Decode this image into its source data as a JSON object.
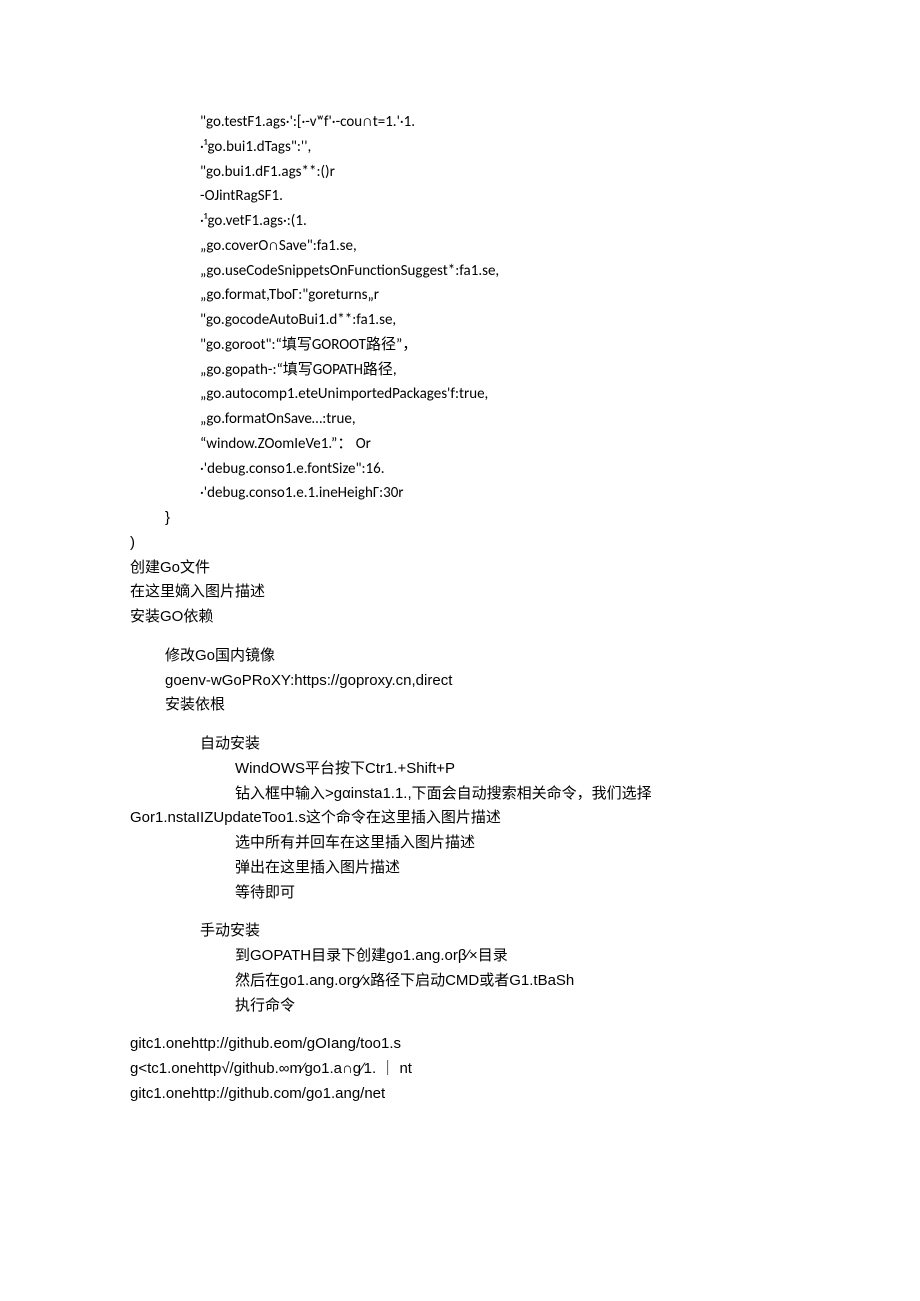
{
  "code": {
    "l1": "\"go.testF1.ags·':[·-vʷf'·-cou∩t=1.'·1.",
    "l2": "·¹go.bui1.dTags\":'',",
    "l3": "\"go.bui1.dF1.ags**:()r",
    "l4": "-OJintRagSF1.",
    "l5": "·¹go.vetF1.ags·:(1.",
    "l6": "„go.coverO∩Save\":fa1.se,",
    "l7": "„go.useCodeSnippetsOnFunctionSuggest*:fa1.se,",
    "l8": "„go.format,TboΓ:\"goreturns„r",
    "l9": "\"go.gocodeAutoBui1.d**:fa1.se,",
    "l10": "\"go.goroot\":“填写GOROOT路径”，",
    "l11": "„go.gopath-:“填写GOPATH路径,",
    "l12": "„go.autocomp1.eteUnimportedPackages'f:true,",
    "l13": "„go.formatOnSave…:true,",
    "l14": "“window.ZOomIeVe1.”： Or",
    "l15": "·'debug.conso1.e.fontSize\":16.",
    "l16": "·'debug.conso1.e.1.ineHeighΓ:30r",
    "l17": "}",
    "l18": ")"
  },
  "text": {
    "t1": "创建Go文件",
    "t2": "在这里嫡入图片描述",
    "t3": "安装GO依赖",
    "t4": "修改Go国内镜像",
    "t5": "goenv-wGoPRoXY:https://goproxy.cn,direct",
    "t6": "安装依根",
    "t7": "自动安装",
    "t8": "WindOWS平台按下Ctr1.+Shift+P",
    "t9": "钻入框中输入>gαinsta1.1.,下面会自动搜索相关命令，我们选择",
    "t10": "Gor1.nstaIIZUpdateToo1.s这个命令在这里插入图片描述",
    "t11": "选中所有并回车在这里插入图片描述",
    "t12": "弹出在这里插入图片描述",
    "t13": "等待即可",
    "t14": "手动安装",
    "t15": "到GOPATH目录下创建go1.ang.orβ∕×目录",
    "t16": "然后在go1.ang.org∕x路径下启动CMD或者G1.tBaSh",
    "t17": "执行命令",
    "t18": "gitc1.onehttp://github.eom/gOIang/too1.s",
    "t19": "g<tc1.onehttp√/github.∞m∕go1.a∩g∕1. ｜ nt",
    "t20": "gitc1.onehttp://github.com/go1.ang/net"
  }
}
